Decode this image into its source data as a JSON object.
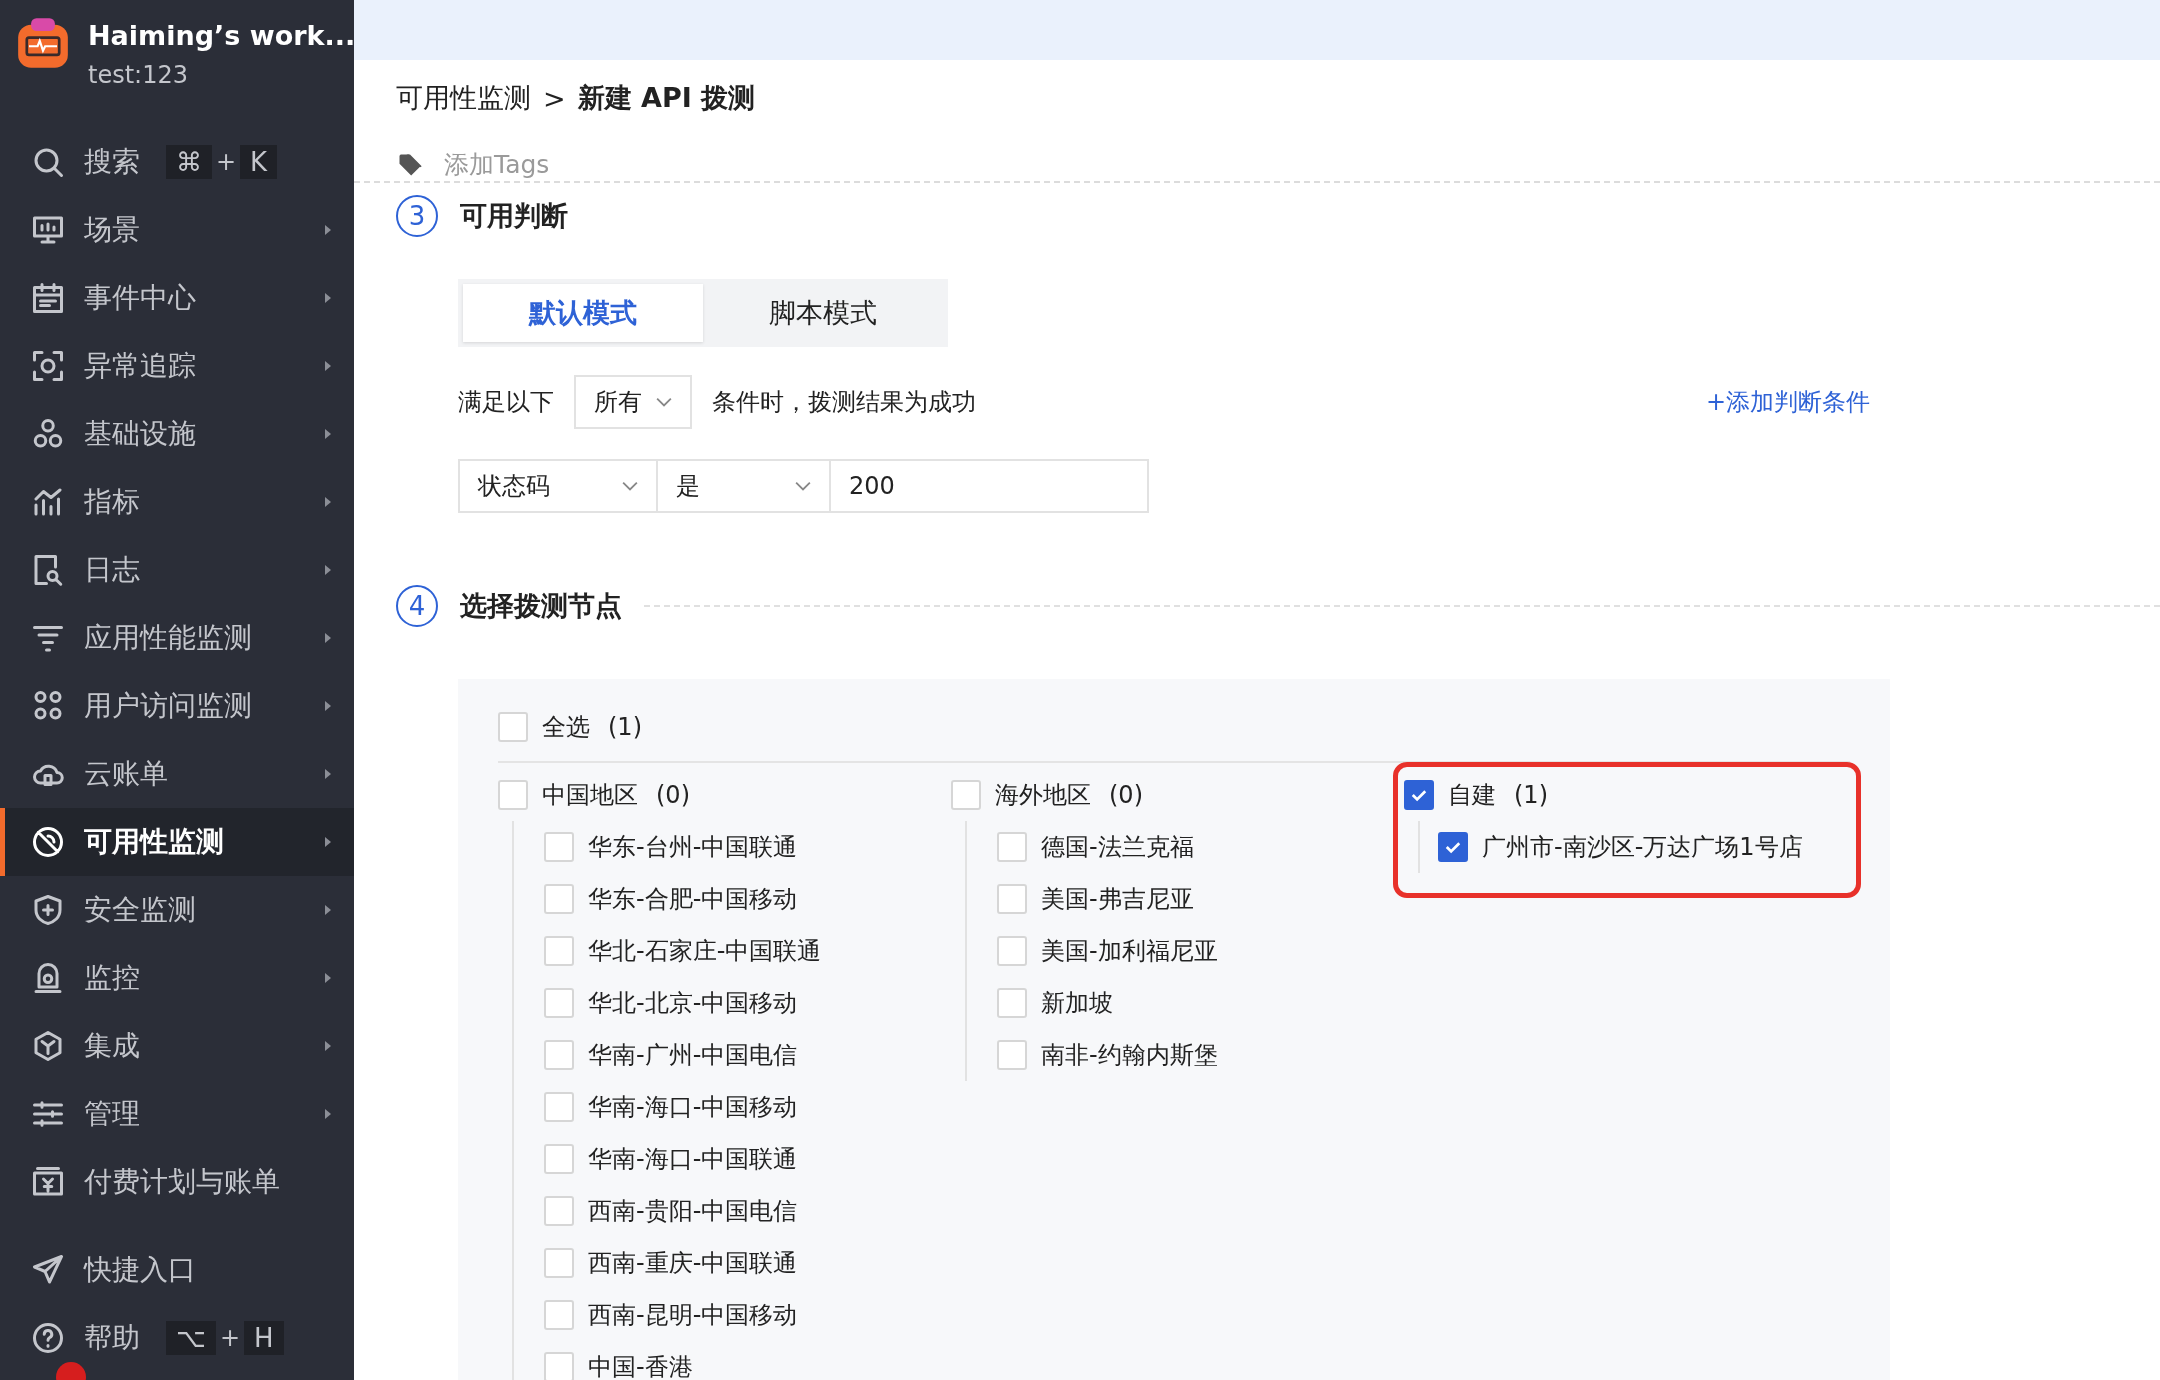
{
  "workspace": {
    "name": "Haiming’s work...",
    "user": "test:123"
  },
  "sidebar": {
    "items": [
      {
        "label": "搜索",
        "selected": false,
        "has_submenu": false,
        "shortcut": {
          "keys": [
            "⌘",
            "K"
          ],
          "joiner": "+"
        }
      },
      {
        "label": "场景",
        "selected": false,
        "has_submenu": true
      },
      {
        "label": "事件中心",
        "selected": false,
        "has_submenu": true
      },
      {
        "label": "异常追踪",
        "selected": false,
        "has_submenu": true
      },
      {
        "label": "基础设施",
        "selected": false,
        "has_submenu": true
      },
      {
        "label": "指标",
        "selected": false,
        "has_submenu": true
      },
      {
        "label": "日志",
        "selected": false,
        "has_submenu": true
      },
      {
        "label": "应用性能监测",
        "selected": false,
        "has_submenu": true
      },
      {
        "label": "用户访问监测",
        "selected": false,
        "has_submenu": true
      },
      {
        "label": "云账单",
        "selected": false,
        "has_submenu": true
      },
      {
        "label": "可用性监测",
        "selected": true,
        "has_submenu": true
      },
      {
        "label": "安全监测",
        "selected": false,
        "has_submenu": true
      },
      {
        "label": "监控",
        "selected": false,
        "has_submenu": true
      },
      {
        "label": "集成",
        "selected": false,
        "has_submenu": true
      },
      {
        "label": "管理",
        "selected": false,
        "has_submenu": true
      },
      {
        "label": "付费计划与账单",
        "selected": false,
        "has_submenu": false
      }
    ],
    "bottom_items": [
      {
        "label": "快捷入口",
        "selected": false,
        "has_submenu": false
      },
      {
        "label": "帮助",
        "selected": false,
        "has_submenu": false,
        "shortcut": {
          "keys": [
            "⌥",
            "H"
          ],
          "joiner": "+"
        }
      }
    ]
  },
  "breadcrumb": {
    "items": [
      "可用性监测",
      "新建 API 拨测"
    ],
    "separator": ">"
  },
  "add_tags": "添加Tags",
  "steps": [
    {
      "number": "3",
      "title": "可用判断"
    },
    {
      "number": "4",
      "title": "选择拨测节点"
    }
  ],
  "mode_tabs": [
    {
      "label": "默认模式",
      "selected": true
    },
    {
      "label": "脚本模式",
      "selected": false
    }
  ],
  "condition": {
    "prefix": "满足以下",
    "match": "所有",
    "suffix": "条件时，拨测结果为成功",
    "add_link": "+添加判断条件"
  },
  "rule": {
    "field": "状态码",
    "operator": "是",
    "value": "200"
  },
  "nodes": {
    "select_all": {
      "label": "全选",
      "count": "(1)",
      "checked": false
    },
    "groups": [
      {
        "label": "中国地区",
        "count": "(0)",
        "checked": false,
        "highlighted": false,
        "children": [
          {
            "label": "华东-台州-中国联通",
            "checked": false
          },
          {
            "label": "华东-合肥-中国移动",
            "checked": false
          },
          {
            "label": "华北-石家庄-中国联通",
            "checked": false
          },
          {
            "label": "华北-北京-中国移动",
            "checked": false
          },
          {
            "label": "华南-广州-中国电信",
            "checked": false
          },
          {
            "label": "华南-海口-中国移动",
            "checked": false
          },
          {
            "label": "华南-海口-中国联通",
            "checked": false
          },
          {
            "label": "西南-贵阳-中国电信",
            "checked": false
          },
          {
            "label": "西南-重庆-中国联通",
            "checked": false
          },
          {
            "label": "西南-昆明-中国移动",
            "checked": false
          },
          {
            "label": "中国-香港",
            "checked": false
          }
        ]
      },
      {
        "label": "海外地区",
        "count": "(0)",
        "checked": false,
        "highlighted": false,
        "children": [
          {
            "label": "德国-法兰克福",
            "checked": false
          },
          {
            "label": "美国-弗吉尼亚",
            "checked": false
          },
          {
            "label": "美国-加利福尼亚",
            "checked": false
          },
          {
            "label": "新加坡",
            "checked": false
          },
          {
            "label": "南非-约翰内斯堡",
            "checked": false
          }
        ]
      },
      {
        "label": "自建",
        "count": "(1)",
        "checked": true,
        "highlighted": true,
        "children": [
          {
            "label": "广州市-南沙区-万达广场1号店",
            "checked": true
          }
        ]
      }
    ]
  }
}
